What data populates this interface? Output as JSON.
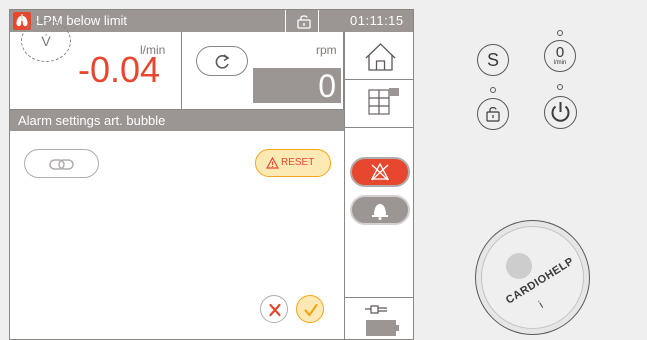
{
  "titlebar": {
    "alarm_text": "LPM below limit",
    "clock": "01:11:15"
  },
  "flow": {
    "symbol": "V̇",
    "unit": "l/min",
    "value": "-0.04"
  },
  "pump": {
    "unit": "rpm",
    "value": "0"
  },
  "section": {
    "title": "Alarm settings art. bubble"
  },
  "buttons": {
    "reset_label": "RESET"
  },
  "hardware": {
    "s_label": "S",
    "zero_label": "0",
    "zero_unit": "l/min",
    "brand": "CARDIOHELP",
    "brand_sub": "i"
  },
  "colors": {
    "alarm_red": "#e8472f",
    "header_gray": "#9b9593",
    "warning_amber": "#f3a51d",
    "warning_fill": "#fde9b4"
  }
}
